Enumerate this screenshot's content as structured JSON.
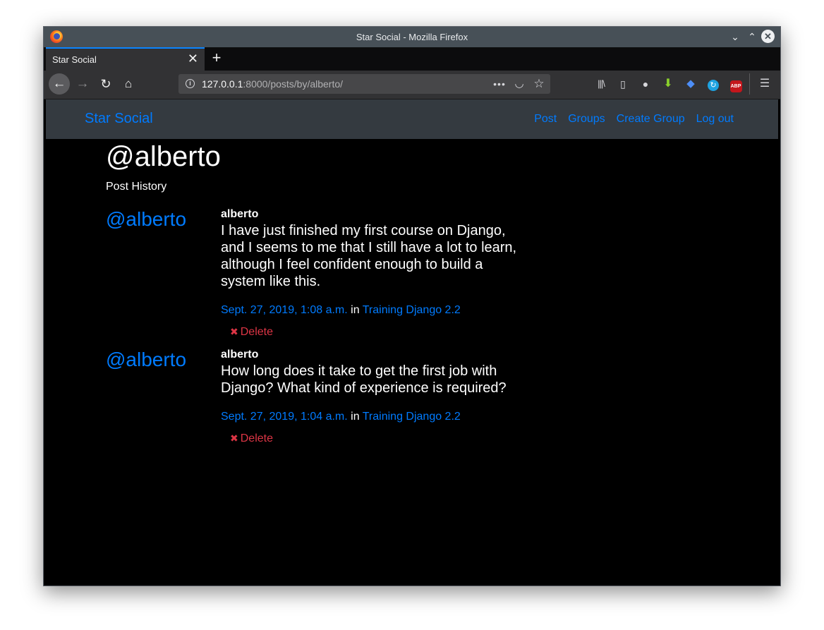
{
  "window": {
    "title": "Star Social - Mozilla Firefox",
    "controls": {
      "minimize": "⌄",
      "maximize": "⌃",
      "close": "✕"
    }
  },
  "browser": {
    "tab": {
      "title": "Star Social",
      "close": "✕"
    },
    "new_tab": "+",
    "nav": {
      "back": "←",
      "forward": "→",
      "reload": "↻",
      "home": "⌂"
    },
    "url": {
      "host": "127.0.0.1",
      "rest": ":8000/posts/by/alberto/"
    },
    "url_icons": {
      "info": "i",
      "more": "•••",
      "pocket": "◡",
      "bookmark": "☆"
    },
    "toolbar_icons": {
      "library": "|||\\",
      "sidebar": "▯",
      "account": "●",
      "downloads": "⬇",
      "extension": "◆",
      "sync": "↻",
      "adblock": "ABP",
      "menu": "☰"
    }
  },
  "site": {
    "brand": "Star Social",
    "nav_links": [
      "Post",
      "Groups",
      "Create Group",
      "Log out"
    ]
  },
  "profile": {
    "title": "@alberto",
    "subtitle": "Post History"
  },
  "posts": [
    {
      "handle": "@alberto",
      "user": "alberto",
      "message": "I have just finished my first course on Django, and I seems to me that I still have a lot to learn, although I feel confident enough to build a system like this.",
      "date": "Sept. 27, 2019, 1:08 a.m.",
      "in_label": "in",
      "group": "Training Django 2.2",
      "delete_label": "Delete",
      "delete_icon": "✖"
    },
    {
      "handle": "@alberto",
      "user": "alberto",
      "message": "How long does it take to get the first job with Django? What kind of experience is required?",
      "date": "Sept. 27, 2019, 1:04 a.m.",
      "in_label": "in",
      "group": "Training Django 2.2",
      "delete_label": "Delete",
      "delete_icon": "✖"
    }
  ],
  "colors": {
    "link": "#007bff",
    "danger": "#dc3545",
    "navbar": "#343a40",
    "page_bg": "#000000"
  }
}
